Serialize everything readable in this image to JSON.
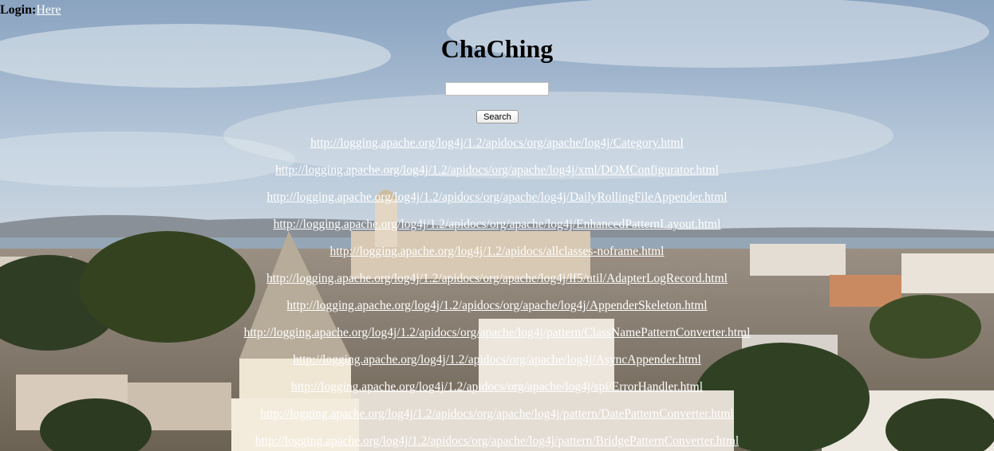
{
  "login": {
    "label": "Login:",
    "link_text": "Here"
  },
  "title": "ChaChing",
  "search": {
    "value": "",
    "placeholder": "",
    "button_label": "Search"
  },
  "results": [
    "http://logging.apache.org/log4j/1.2/apidocs/org/apache/log4j/Category.html",
    "http://logging.apache.org/log4j/1.2/apidocs/org/apache/log4j/xml/DOMConfigurator.html",
    "http://logging.apache.org/log4j/1.2/apidocs/org/apache/log4j/DailyRollingFileAppender.html",
    "http://logging.apache.org/log4j/1.2/apidocs/org/apache/log4j/EnhancedPatternLayout.html",
    "http://logging.apache.org/log4j/1.2/apidocs/allclasses-noframe.html",
    "http://logging.apache.org/log4j/1.2/apidocs/org/apache/log4j/lf5/util/AdapterLogRecord.html",
    "http://logging.apache.org/log4j/1.2/apidocs/org/apache/log4j/AppenderSkeleton.html",
    "http://logging.apache.org/log4j/1.2/apidocs/org/apache/log4j/pattern/ClassNamePatternConverter.html",
    "http://logging.apache.org/log4j/1.2/apidocs/org/apache/log4j/AsyncAppender.html",
    "http://logging.apache.org/log4j/1.2/apidocs/org/apache/log4j/spi/ErrorHandler.html",
    "http://logging.apache.org/log4j/1.2/apidocs/org/apache/log4j/pattern/DatePatternConverter.html",
    "http://logging.apache.org/log4j/1.2/apidocs/org/apache/log4j/pattern/BridgePatternConverter.html"
  ],
  "colors": {
    "link": "#ffffff",
    "text": "#000000",
    "sky": "#a9bfd6"
  }
}
